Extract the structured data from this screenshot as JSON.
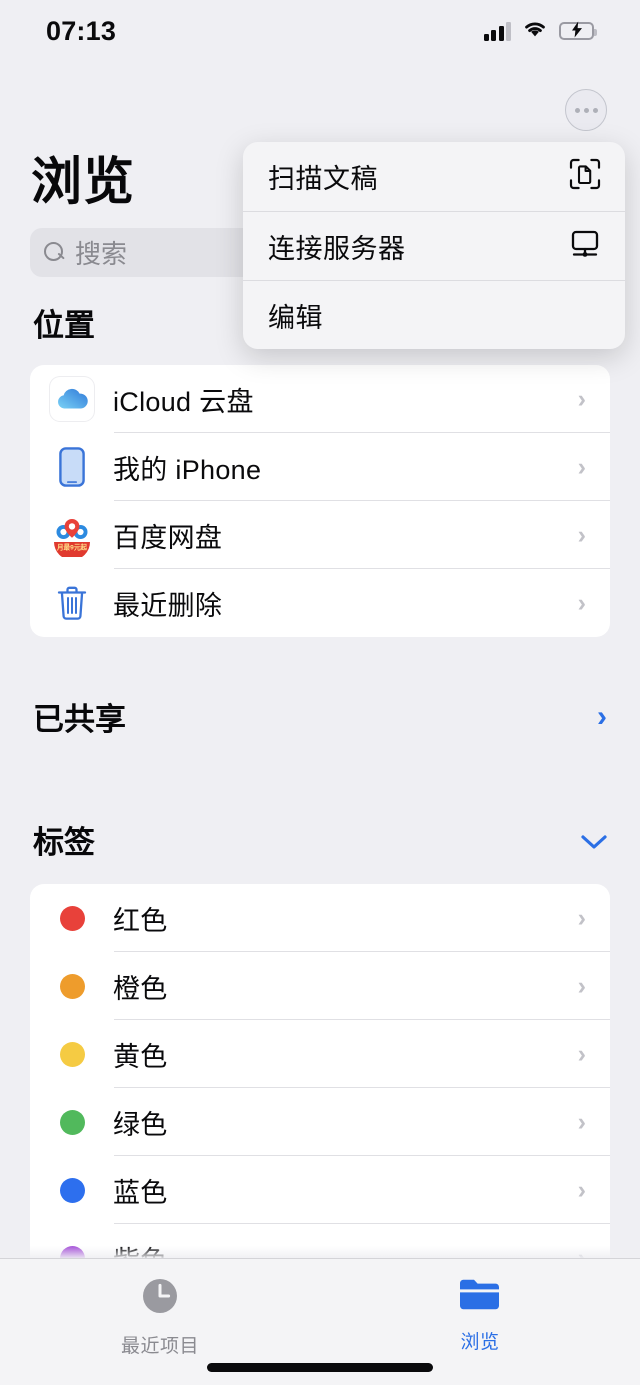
{
  "status_bar": {
    "time": "07:13",
    "signal_icon": "cellular-bars-icon",
    "wifi_icon": "wifi-icon",
    "battery_icon": "battery-charging-icon",
    "battery_charging": true
  },
  "header": {
    "title": "浏览",
    "more_button_icon": "ellipsis-circle-icon"
  },
  "search": {
    "placeholder": "搜索",
    "value": "",
    "icon": "search-icon"
  },
  "context_menu": {
    "items": [
      {
        "label": "扫描文稿",
        "icon": "document-scanner-icon"
      },
      {
        "label": "连接服务器",
        "icon": "server-monitor-icon"
      },
      {
        "label": "编辑",
        "icon": ""
      }
    ]
  },
  "locations": {
    "title": "位置",
    "items": [
      {
        "label": "iCloud 云盘",
        "icon": "icloud-drive-icon",
        "chevron": "chevron-right-icon"
      },
      {
        "label": "我的 iPhone",
        "icon": "iphone-icon",
        "chevron": "chevron-right-icon"
      },
      {
        "label": "百度网盘",
        "icon": "baidu-netdisk-icon",
        "chevron": "chevron-right-icon"
      },
      {
        "label": "最近删除",
        "icon": "trash-icon",
        "chevron": "chevron-right-icon"
      }
    ]
  },
  "shared": {
    "title": "已共享",
    "chevron": "chevron-right-icon"
  },
  "tags": {
    "title": "标签",
    "chevron": "chevron-down-icon",
    "items": [
      {
        "label": "红色",
        "color": "#E8413A",
        "chevron": "chevron-right-icon"
      },
      {
        "label": "橙色",
        "color": "#EE9C2C",
        "chevron": "chevron-right-icon"
      },
      {
        "label": "黄色",
        "color": "#F5CB43",
        "chevron": "chevron-right-icon"
      },
      {
        "label": "绿色",
        "color": "#51B95C",
        "chevron": "chevron-right-icon"
      },
      {
        "label": "蓝色",
        "color": "#2D6FEE",
        "chevron": "chevron-right-icon"
      },
      {
        "label": "紫色",
        "color": "#A755D9",
        "chevron": "chevron-right-icon"
      }
    ]
  },
  "tab_bar": {
    "tabs": [
      {
        "label": "最近项目",
        "icon": "clock-icon",
        "active": false
      },
      {
        "label": "浏览",
        "icon": "folder-icon",
        "active": true
      }
    ]
  },
  "theme": {
    "accent": "#2B6FE5",
    "background": "#EFEFF3",
    "card": "#FFFFFF",
    "menu_background": "#F4F4F6",
    "text_primary": "#0A0A0C",
    "text_secondary": "#8A8A90",
    "separator": "#E0E0E4",
    "battery_green": "#35C759"
  },
  "glyphs": {
    "chevron_right": "›",
    "chevron_down": "⌄",
    "bolt": "⚡"
  }
}
